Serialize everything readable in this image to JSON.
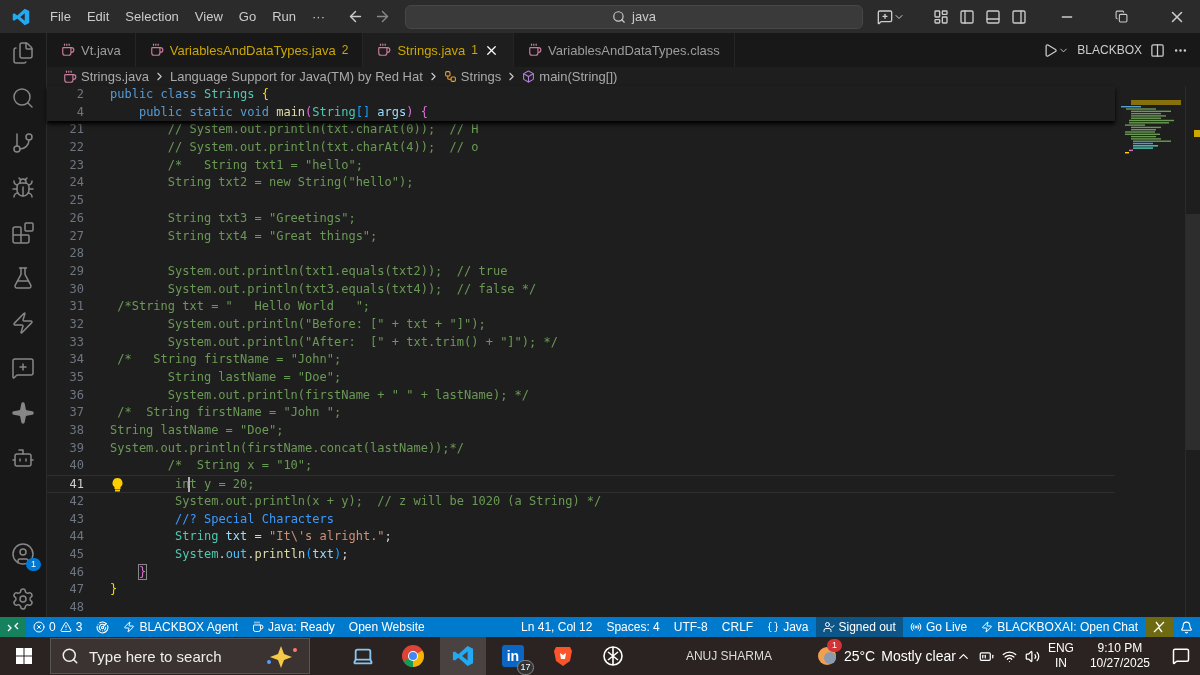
{
  "menu": [
    "File",
    "Edit",
    "Selection",
    "View",
    "Go",
    "Run"
  ],
  "menu_more": "···",
  "search": {
    "value": "java"
  },
  "activity_bar": [
    {
      "kind": "explorer",
      "selected": false
    },
    {
      "kind": "search",
      "selected": false
    },
    {
      "kind": "source_control",
      "selected": false
    },
    {
      "kind": "run_debug",
      "selected": false
    },
    {
      "kind": "extensions",
      "selected": false
    },
    {
      "kind": "testing",
      "selected": false
    },
    {
      "kind": "bolt",
      "selected": false
    },
    {
      "kind": "chat",
      "selected": false
    },
    {
      "kind": "sparkle",
      "selected": false
    },
    {
      "kind": "robot",
      "selected": false
    }
  ],
  "account": {
    "badge": "1"
  },
  "tabs": [
    {
      "label": "Vt.java",
      "selected": false,
      "warning": false
    },
    {
      "label": "VariablesAndDataTypes.java",
      "badge": "2",
      "selected": false,
      "warning": true
    },
    {
      "label": "Strings.java",
      "badge": "1",
      "selected": true,
      "warning": true
    },
    {
      "label": "VariablesAndDataTypes.class",
      "selected": false,
      "warning": false
    }
  ],
  "editor_actions": {
    "label": "BLACKBOX"
  },
  "breadcrumb": [
    {
      "kind": "file",
      "label": "Strings.java"
    },
    {
      "kind": "text",
      "label": "Language Support for Java(TM) by Red Hat"
    },
    {
      "kind": "class",
      "label": "Strings"
    },
    {
      "kind": "method",
      "label": "main(String[])"
    }
  ],
  "sticky_lines": [
    {
      "number": "2",
      "tokens": [
        {
          "t": "public class ",
          "kind": "kw"
        },
        {
          "t": "Strings ",
          "kind": "type"
        },
        {
          "t": "{",
          "kind": "b1"
        }
      ]
    },
    {
      "number": "4",
      "tokens": [
        {
          "t": "    public static void ",
          "kind": "kw"
        },
        {
          "t": "main",
          "kind": "fn"
        },
        {
          "t": "(",
          "kind": "b2"
        },
        {
          "t": "String",
          "kind": "type"
        },
        {
          "t": "[]",
          "kind": "b3"
        },
        {
          "t": " args",
          "kind": "var"
        },
        {
          "t": ")",
          "kind": "b2"
        },
        {
          "t": " {",
          "kind": "b2"
        }
      ]
    }
  ],
  "lines": [
    {
      "number": "21",
      "current": false,
      "lightbulb": false,
      "tokens": [
        {
          "t": "        // System.out.println(txt.charAt(0));  // H",
          "kind": "cm"
        }
      ]
    },
    {
      "number": "22",
      "current": false,
      "lightbulb": false,
      "tokens": [
        {
          "t": "        // System.out.println(txt.charAt(4));  // o",
          "kind": "cm"
        }
      ]
    },
    {
      "number": "23",
      "current": false,
      "lightbulb": false,
      "tokens": [
        {
          "t": "        /*   String txt1 = \"hello\";",
          "kind": "cm"
        }
      ]
    },
    {
      "number": "24",
      "current": false,
      "lightbulb": false,
      "tokens": [
        {
          "t": "        String txt2 = new String(\"hello\");",
          "kind": "cm"
        }
      ]
    },
    {
      "number": "25",
      "current": false,
      "lightbulb": false
    },
    {
      "number": "26",
      "current": false,
      "lightbulb": false,
      "tokens": [
        {
          "t": "        String txt3 = \"Greetings\";",
          "kind": "cm"
        }
      ]
    },
    {
      "number": "27",
      "current": false,
      "lightbulb": false,
      "tokens": [
        {
          "t": "        String txt4 = \"Great things\";",
          "kind": "cm"
        }
      ]
    },
    {
      "number": "28",
      "current": false,
      "lightbulb": false
    },
    {
      "number": "29",
      "current": false,
      "lightbulb": false,
      "tokens": [
        {
          "t": "        System.out.println(txt1.equals(txt2));  // true",
          "kind": "cm"
        }
      ]
    },
    {
      "number": "30",
      "current": false,
      "lightbulb": false,
      "tokens": [
        {
          "t": "        System.out.println(txt3.equals(txt4));  // false */",
          "kind": "cm"
        }
      ]
    },
    {
      "number": "31",
      "current": false,
      "lightbulb": false,
      "tokens": [
        {
          "t": " /*String txt = \"   Hello World   \";",
          "kind": "cm"
        }
      ]
    },
    {
      "number": "32",
      "current": false,
      "lightbulb": false,
      "tokens": [
        {
          "t": "        System.out.println(\"Before: [\" + txt + \"]\");",
          "kind": "cm"
        }
      ]
    },
    {
      "number": "33",
      "current": false,
      "lightbulb": false,
      "tokens": [
        {
          "t": "        System.out.println(\"After:  [\" + txt.trim() + \"]\"); */",
          "kind": "cm"
        }
      ]
    },
    {
      "number": "34",
      "current": false,
      "lightbulb": false,
      "tokens": [
        {
          "t": " /*   String firstName = \"John\";",
          "kind": "cm"
        }
      ]
    },
    {
      "number": "35",
      "current": false,
      "lightbulb": false,
      "tokens": [
        {
          "t": "        String lastName = \"Doe\";",
          "kind": "cm"
        }
      ]
    },
    {
      "number": "36",
      "current": false,
      "lightbulb": false,
      "tokens": [
        {
          "t": "        System.out.println(firstName + \" \" + lastName); */",
          "kind": "cm"
        }
      ]
    },
    {
      "number": "37",
      "current": false,
      "lightbulb": false,
      "tokens": [
        {
          "t": " /*  String firstName = \"John \";",
          "kind": "cm"
        }
      ]
    },
    {
      "number": "38",
      "current": false,
      "lightbulb": false,
      "tokens": [
        {
          "t": "String lastName = \"Doe\";",
          "kind": "cm"
        }
      ]
    },
    {
      "number": "39",
      "current": false,
      "lightbulb": false,
      "tokens": [
        {
          "t": "System.out.println(firstName.concat(lastName));*/",
          "kind": "cm"
        }
      ]
    },
    {
      "number": "40",
      "current": false,
      "lightbulb": false,
      "tokens": [
        {
          "t": "        /*  String x = \"10\";",
          "kind": "cm"
        }
      ]
    },
    {
      "number": "41",
      "current": true,
      "lightbulb": true,
      "tokens": [
        {
          "t": "         in",
          "kind": "cm"
        },
        {
          "kind": "cursor"
        },
        {
          "t": "t y = 20;",
          "kind": "cm"
        }
      ]
    },
    {
      "number": "42",
      "current": false,
      "lightbulb": false,
      "tokens": [
        {
          "t": "         System.out.println(x + y);  // z will be 1020 (a String) */",
          "kind": "cm"
        }
      ]
    },
    {
      "number": "43",
      "current": false,
      "lightbulb": false,
      "tokens": [
        {
          "t": "         //? Special Characters",
          "kind": "special"
        }
      ]
    },
    {
      "number": "44",
      "current": false,
      "lightbulb": false,
      "tokens": [
        {
          "t": "         String",
          "kind": "type"
        },
        {
          "t": " txt",
          "kind": "var"
        },
        {
          "t": " = ",
          "kind": "op"
        },
        {
          "t": "\"It\\'s alright.\"",
          "kind": "str"
        },
        {
          "t": ";",
          "kind": "op"
        }
      ]
    },
    {
      "number": "45",
      "current": false,
      "lightbulb": false,
      "tokens": [
        {
          "t": "         System",
          "kind": "type"
        },
        {
          "t": ".",
          "kind": "op"
        },
        {
          "t": "out",
          "kind": "prop"
        },
        {
          "t": ".",
          "kind": "op"
        },
        {
          "t": "println",
          "kind": "fn"
        },
        {
          "t": "(",
          "kind": "b3"
        },
        {
          "t": "txt",
          "kind": "var"
        },
        {
          "t": ")",
          "kind": "b3"
        },
        {
          "t": ";",
          "kind": "op"
        }
      ]
    },
    {
      "number": "46",
      "current": false,
      "lightbulb": false,
      "tokens": [
        {
          "t": "    }",
          "kind": "match"
        }
      ]
    },
    {
      "number": "47",
      "current": false,
      "lightbulb": false,
      "tokens": [
        {
          "t": "}",
          "kind": "b1"
        }
      ]
    },
    {
      "number": "48",
      "current": false,
      "lightbulb": false
    }
  ],
  "status_left": [
    {
      "kind": "remote"
    },
    {
      "kind": "problems",
      "errors": "0",
      "warnings": "3"
    },
    {
      "kind": "ports"
    },
    {
      "kind": "bolt",
      "label": "BLACKBOX Agent"
    },
    {
      "kind": "java",
      "label": "Java: Ready"
    },
    {
      "kind": "plain",
      "label": "Open Website"
    }
  ],
  "status_right": [
    {
      "kind": "plain",
      "label": "Ln 41, Col 12"
    },
    {
      "kind": "plain",
      "label": "Spaces: 4"
    },
    {
      "kind": "plain",
      "label": "UTF-8"
    },
    {
      "kind": "plain",
      "label": "CRLF"
    },
    {
      "kind": "language",
      "label": "Java"
    },
    {
      "kind": "account",
      "label": "Signed out"
    },
    {
      "kind": "live",
      "label": "Go Live"
    },
    {
      "kind": "bolt",
      "label": "BLACKBOXAI: Open Chat"
    },
    {
      "kind": "toggle"
    },
    {
      "kind": "bell"
    }
  ],
  "taskbar": {
    "search_placeholder": "Type here to search",
    "apps": [
      {
        "kind": "laptop",
        "selected": false
      },
      {
        "kind": "browser",
        "selected": false
      },
      {
        "kind": "vscode",
        "selected": true
      },
      {
        "kind": "linkedin",
        "label": "in",
        "badge": "17",
        "selected": false
      },
      {
        "kind": "lion",
        "selected": false
      },
      {
        "kind": "knot",
        "selected": false
      }
    ],
    "user": "ANUJ SHARMA",
    "weather": {
      "badge": "1",
      "temperature": "25°C",
      "condition": "Mostly clear"
    },
    "language": [
      "ENG",
      "IN"
    ],
    "time": "9:10 PM",
    "date": "10/27/2025"
  }
}
